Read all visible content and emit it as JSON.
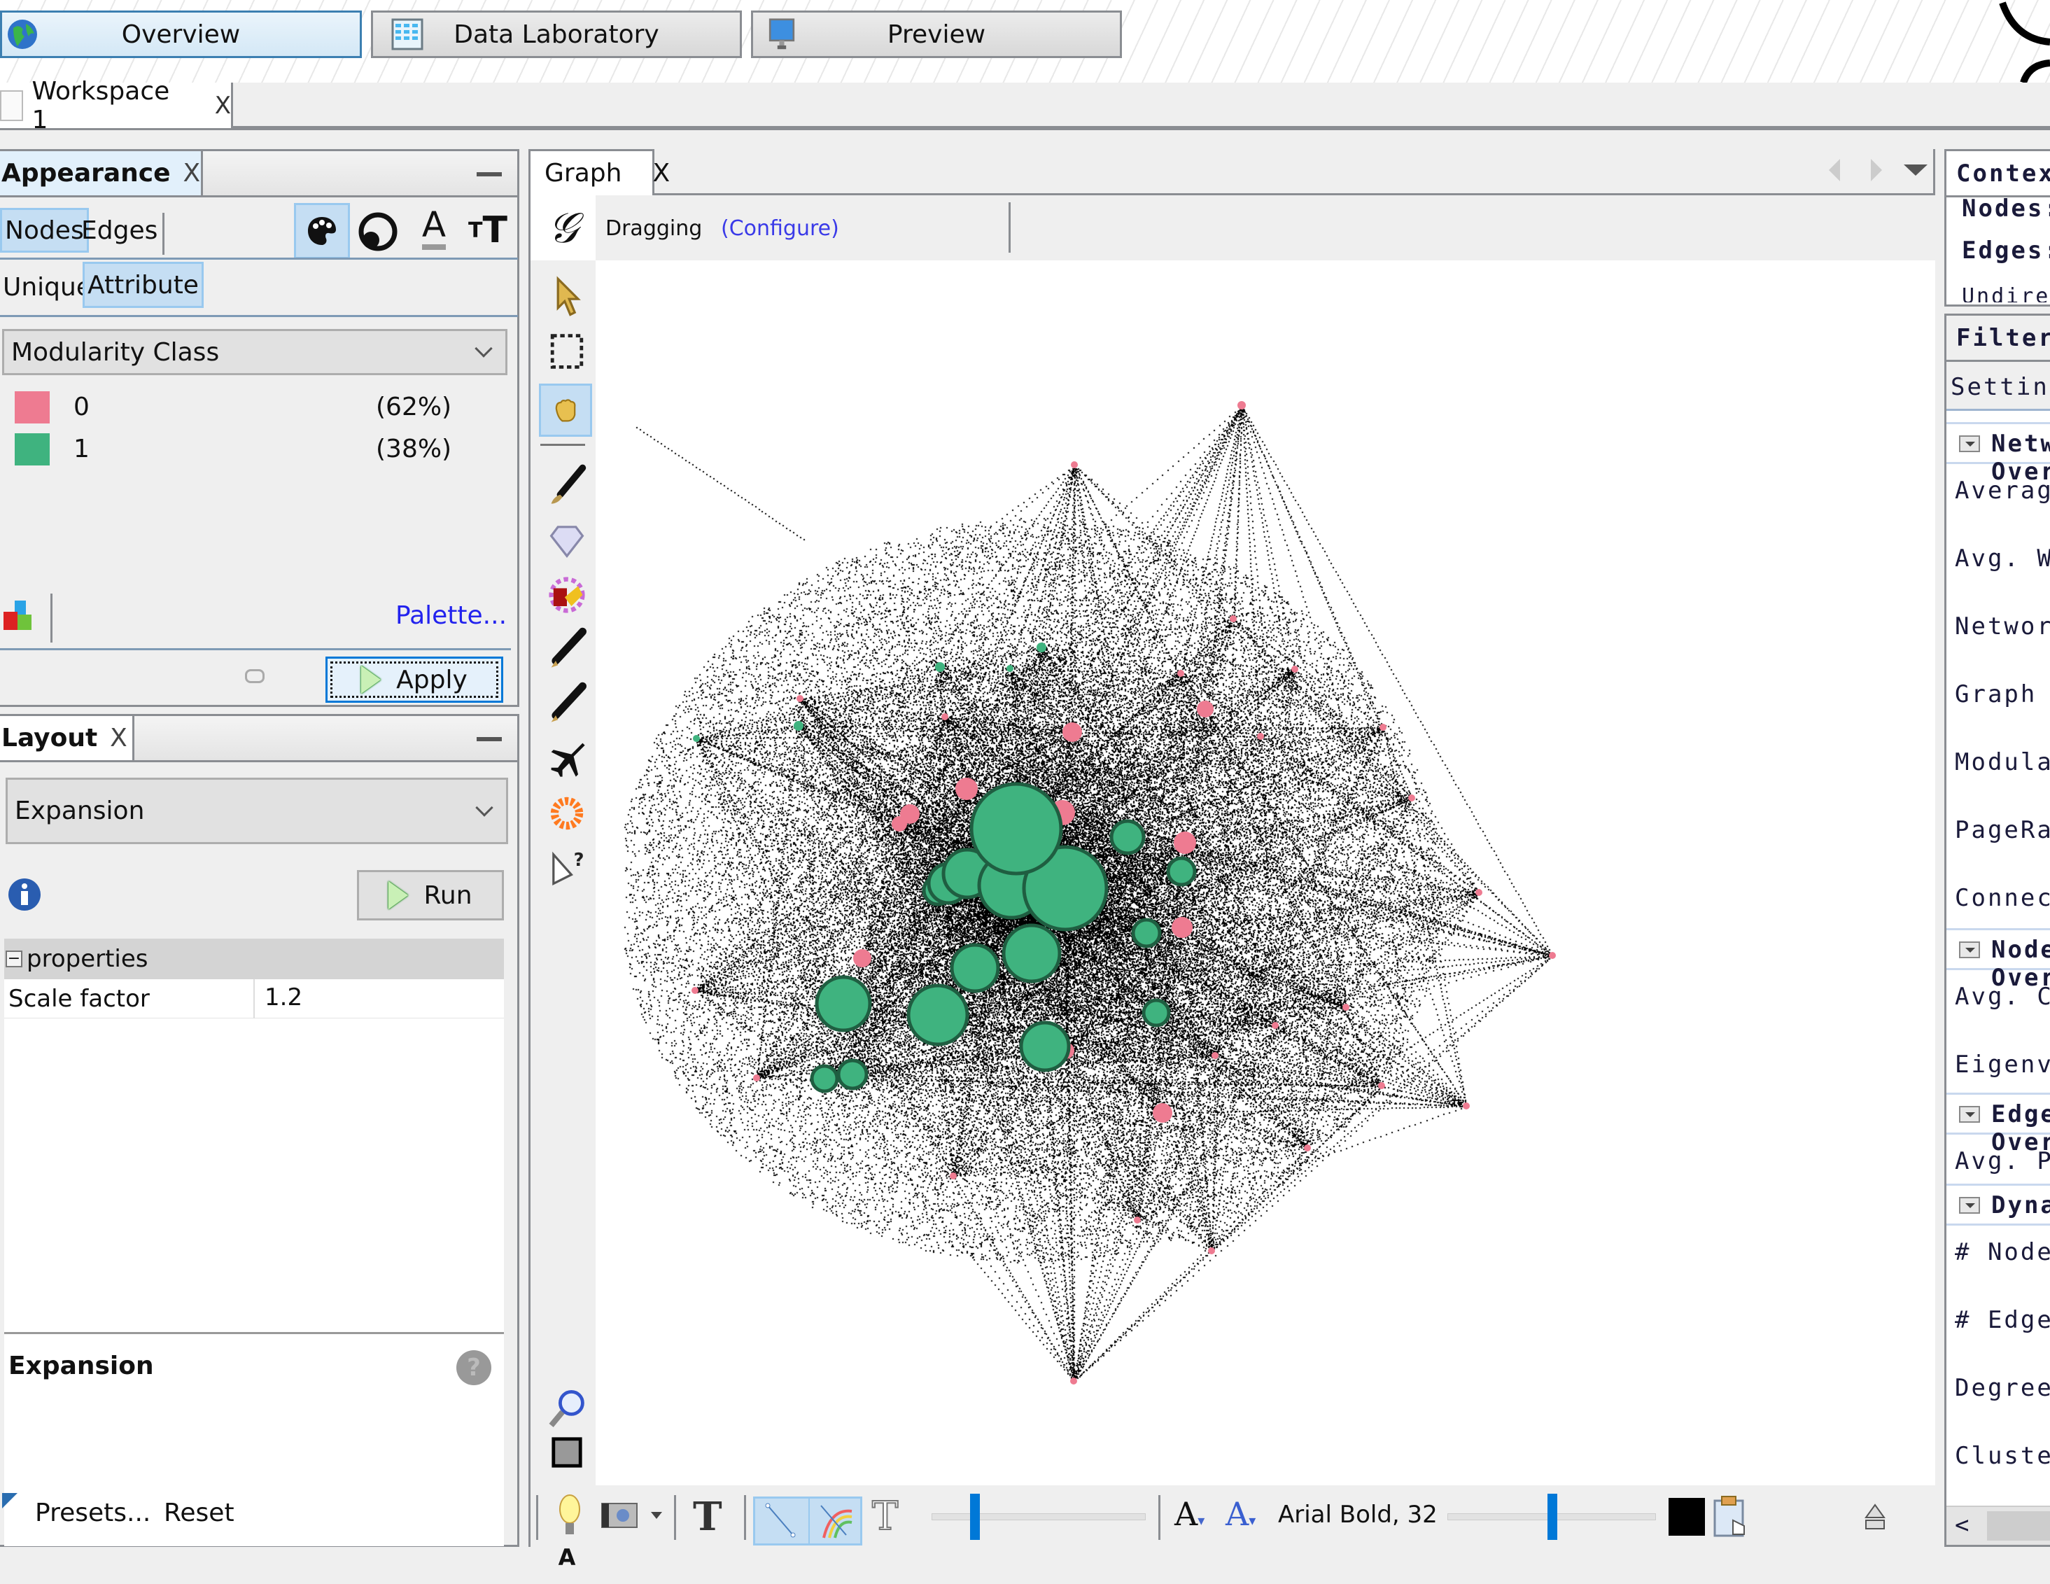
{
  "perspectives": [
    {
      "label": "Overview",
      "icon": "globe-icon",
      "active": true
    },
    {
      "label": "Data Laboratory",
      "icon": "spreadsheet-icon",
      "active": false
    },
    {
      "label": "Preview",
      "icon": "monitor-icon",
      "active": false
    }
  ],
  "workspace_tab": {
    "label": "Workspace 1",
    "close": "X"
  },
  "appearance": {
    "title": "Appearance",
    "close": "X",
    "element_tabs": [
      "Nodes",
      "Edges"
    ],
    "selected_element": "Nodes",
    "property_icons": [
      "color-palette-icon",
      "size-icon",
      "label-color-icon",
      "label-size-icon"
    ],
    "mode_tabs": [
      "Unique",
      "Attribute"
    ],
    "selected_mode": "Attribute",
    "attribute": "Modularity Class",
    "partitions": [
      {
        "value": "0",
        "percent": "(62%)",
        "color": "#ee7b91"
      },
      {
        "value": "1",
        "percent": "(38%)",
        "color": "#3fb37f"
      }
    ],
    "palette_link": "Palette...",
    "apply_label": "Apply"
  },
  "layout": {
    "title": "Layout",
    "close": "X",
    "algorithm": "Expansion",
    "run_label": "Run",
    "properties_group": "properties",
    "properties": [
      {
        "name": "Scale factor",
        "value": "1.2"
      }
    ],
    "description_title": "Expansion",
    "presets_label": "Presets...",
    "reset_label": "Reset"
  },
  "graph": {
    "tab_label": "Graph",
    "close": "X",
    "mode_label": "Dragging",
    "configure_link": "(Configure)",
    "bottom_font_label": "Arial Bold, 32",
    "edge_scale_slider": 0.18,
    "label_size_slider": 0.48,
    "label_color": "#000000",
    "node_colors": {
      "class0": "#ee7b91",
      "class1": "#3fb37f",
      "stroke": "#1f5e41"
    }
  },
  "context": {
    "title": "Context",
    "rows": [
      "Nodes:",
      "Edges:",
      "Undirected"
    ]
  },
  "filters": {
    "title": "Filters",
    "settings": "Settings"
  },
  "statistics": {
    "sections": [
      {
        "title": "Network Overview",
        "items": [
          "Average Degree",
          "Avg. Weighted Degree",
          "Network Diameter",
          "Graph Density",
          "Modularity",
          "PageRank",
          "Connected Components"
        ]
      },
      {
        "title": "Node Overview",
        "items": [
          "Avg. Clustering Coefficient",
          "Eigenvector Centrality"
        ]
      },
      {
        "title": "Edge Overview",
        "items": [
          "Avg. Path Length"
        ]
      },
      {
        "title": "Dynamic",
        "items": [
          "# Nodes",
          "# Edges",
          "Degree",
          "Clustering Coefficient"
        ]
      }
    ]
  }
}
